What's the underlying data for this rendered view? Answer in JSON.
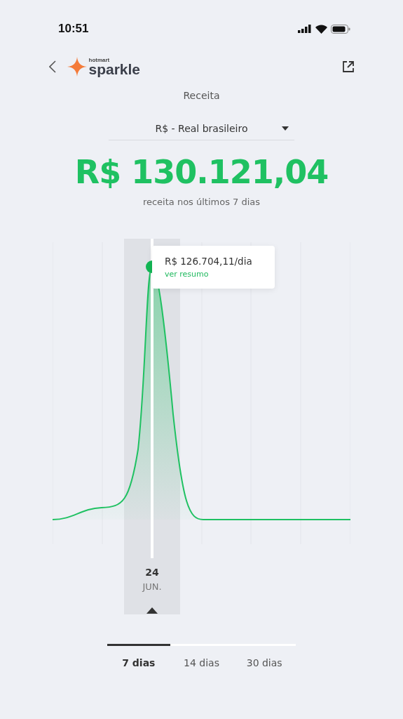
{
  "status_bar": {
    "time": "10:51"
  },
  "header": {
    "logo": {
      "brand": "hotmart",
      "product": "sparkle"
    }
  },
  "title": "Receita",
  "currency_select": {
    "value": "R$ - Real brasileiro"
  },
  "total": {
    "amount": "R$ 130.121,04",
    "caption": "receita nos últimos 7 dias"
  },
  "chart": {
    "tooltip": {
      "value": "R$ 126.704,11/dia",
      "link": "ver resumo"
    },
    "selected_date": {
      "day": "24",
      "month": "JUN."
    }
  },
  "tabs": [
    {
      "label": "7 dias",
      "selected": true
    },
    {
      "label": "14 dias",
      "selected": false
    },
    {
      "label": "30 dias",
      "selected": false
    }
  ]
}
